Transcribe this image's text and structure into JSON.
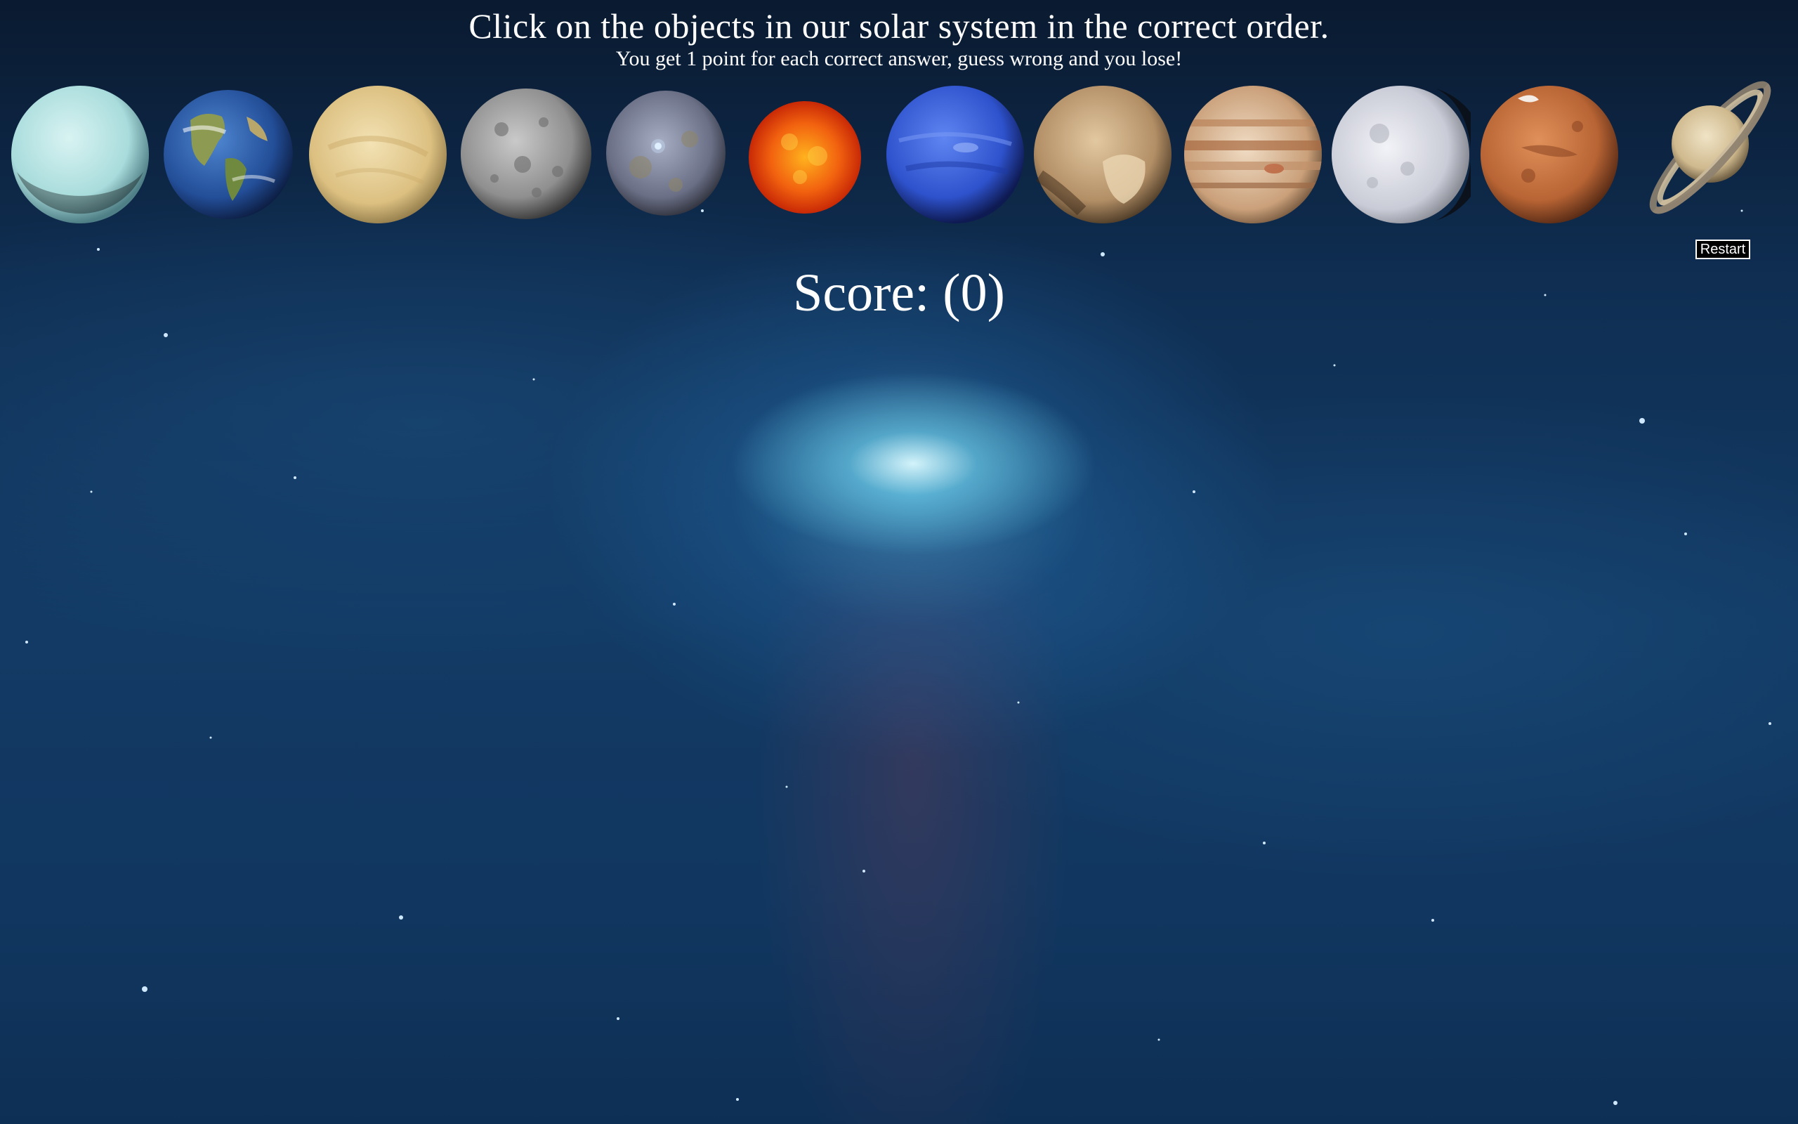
{
  "header": {
    "title": "Click on the objects in our solar system in the correct order.",
    "subtitle": "You get 1 point for each correct answer, guess wrong and you lose!"
  },
  "score": {
    "label": "Score: (0)",
    "value": 0
  },
  "restart": {
    "label": "Restart"
  },
  "objects": [
    {
      "id": "uranus",
      "icon": "uranus-icon",
      "color": "#bfe6e8"
    },
    {
      "id": "earth",
      "icon": "earth-icon",
      "color": "#2f5fa8"
    },
    {
      "id": "venus",
      "icon": "venus-icon",
      "color": "#e6cf94"
    },
    {
      "id": "mercury",
      "icon": "mercury-icon",
      "color": "#9a9a9a"
    },
    {
      "id": "ceres",
      "icon": "ceres-icon",
      "color": "#7a7f96"
    },
    {
      "id": "sun",
      "icon": "sun-icon",
      "color": "#f25a0e"
    },
    {
      "id": "neptune",
      "icon": "neptune-icon",
      "color": "#2f56d6"
    },
    {
      "id": "pluto",
      "icon": "pluto-icon",
      "color": "#c4a47e"
    },
    {
      "id": "jupiter",
      "icon": "jupiter-icon",
      "color": "#d9b38c"
    },
    {
      "id": "moon",
      "icon": "moon-icon",
      "color": "#e4e6ee"
    },
    {
      "id": "mars",
      "icon": "mars-icon",
      "color": "#c26a3a"
    },
    {
      "id": "saturn",
      "icon": "saturn-icon",
      "color": "#d9c7a1"
    }
  ]
}
